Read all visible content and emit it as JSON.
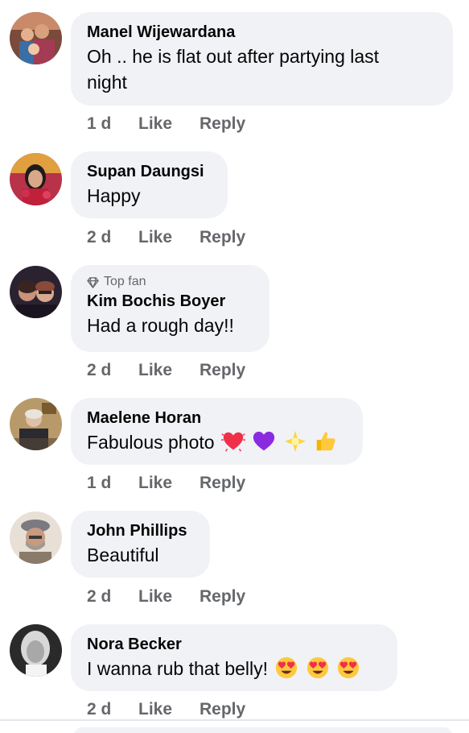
{
  "comments": [
    {
      "author": "Manel Wijewardana",
      "text_line1": "Oh .. he is flat out after partying last",
      "text_line2": "night",
      "time": "1 d",
      "like": "Like",
      "reply": "Reply"
    },
    {
      "author": "Supan Daungsi",
      "text": "Happy",
      "time": "2 d",
      "like": "Like",
      "reply": "Reply"
    },
    {
      "badge": "Top fan",
      "author": "Kim Bochis Boyer",
      "text": "Had a rough day!!",
      "time": "2 d",
      "like": "Like",
      "reply": "Reply"
    },
    {
      "author": "Maelene Horan",
      "text": "Fabulous photo",
      "emojis": [
        "beating-heart-icon",
        "purple-heart-icon",
        "sparkle-star-icon",
        "thumbs-up-icon"
      ],
      "time": "1 d",
      "like": "Like",
      "reply": "Reply"
    },
    {
      "author": "John Phillips",
      "text": "Beautiful",
      "time": "2 d",
      "like": "Like",
      "reply": "Reply"
    },
    {
      "author": "Nora Becker",
      "text": "I wanna rub that belly!",
      "emojis": [
        "heart-eyes-icon",
        "heart-eyes-icon",
        "heart-eyes-icon"
      ],
      "time": "2 d",
      "like": "Like",
      "reply": "Reply"
    }
  ],
  "colors": {
    "bubble": "#f0f2f5",
    "meta_text": "#65676b",
    "primary_text": "#050505"
  }
}
